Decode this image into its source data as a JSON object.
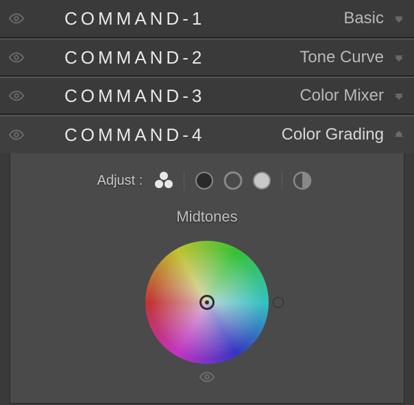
{
  "panels": [
    {
      "shortcut": "COMMAND-1",
      "name": "Basic"
    },
    {
      "shortcut": "COMMAND-2",
      "name": "Tone Curve"
    },
    {
      "shortcut": "COMMAND-3",
      "name": "Color Mixer"
    },
    {
      "shortcut": "COMMAND-4",
      "name": "Color Grading"
    }
  ],
  "colorGrading": {
    "adjustLabel": "Adjust :",
    "sectionLabel": "Midtones"
  }
}
